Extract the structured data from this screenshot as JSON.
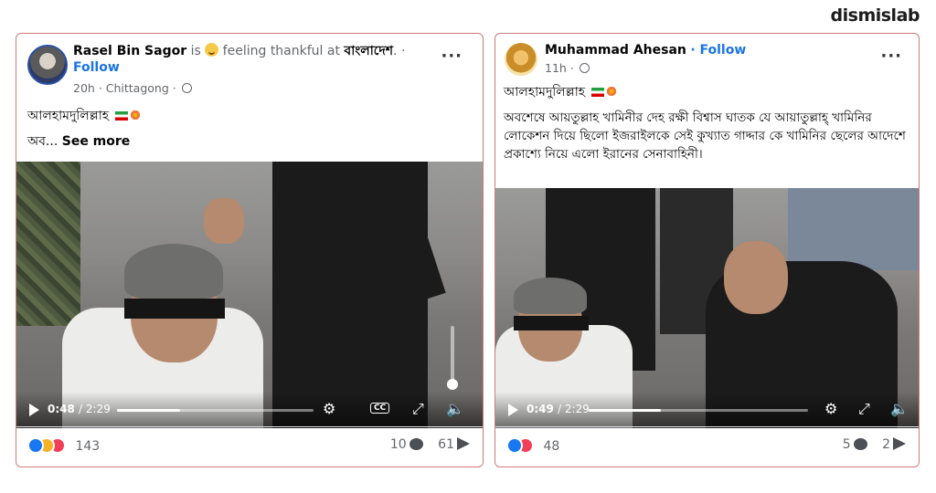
{
  "brand": "dismislab",
  "posts": [
    {
      "author": "Rasel Bin Sagor",
      "is_text": "is",
      "activity": "feeling thankful at",
      "place": "বাংলাদেশ",
      "separator": ".",
      "follow": "Follow",
      "time": "20h · Chittagong ·",
      "line1": "আলহামদুলিল্লাহ",
      "line2_prefix": "অব...",
      "see_more": "See more",
      "video": {
        "current": "0:48",
        "duration": "/ 2:29",
        "progress": 0.32
      },
      "reaction_count": "143",
      "comments": "10",
      "shares": "61"
    },
    {
      "author": "Muhammad Ahesan",
      "follow": "· Follow",
      "time": "11h ·",
      "line1": "আলহামদুলিল্লাহ",
      "body": "অবশেষে আয়তুল্লাহ খামিনীর দেহ রক্ষী বিশ্বাস ঘাতক যে আয়াতুল্লাহ্ খামিনির লোকেশন দিয়ে ছিলো ইজরাইলকে সেই কুখ্যাত গাদ্দার কে খামিনির ছেলের আদেশে প্রকাশ্যে নিয়ে এলো ইরানের সেনাবাহিনী।",
      "video": {
        "current": "0:49",
        "duration": "/ 2:29",
        "progress": 0.33
      },
      "reaction_count": "48",
      "comments": "5",
      "shares": "2"
    }
  ],
  "icons": {
    "more": "···",
    "settings": "⚙",
    "fullscreen": "⤢",
    "mute": "🔈",
    "cc": "CC"
  }
}
